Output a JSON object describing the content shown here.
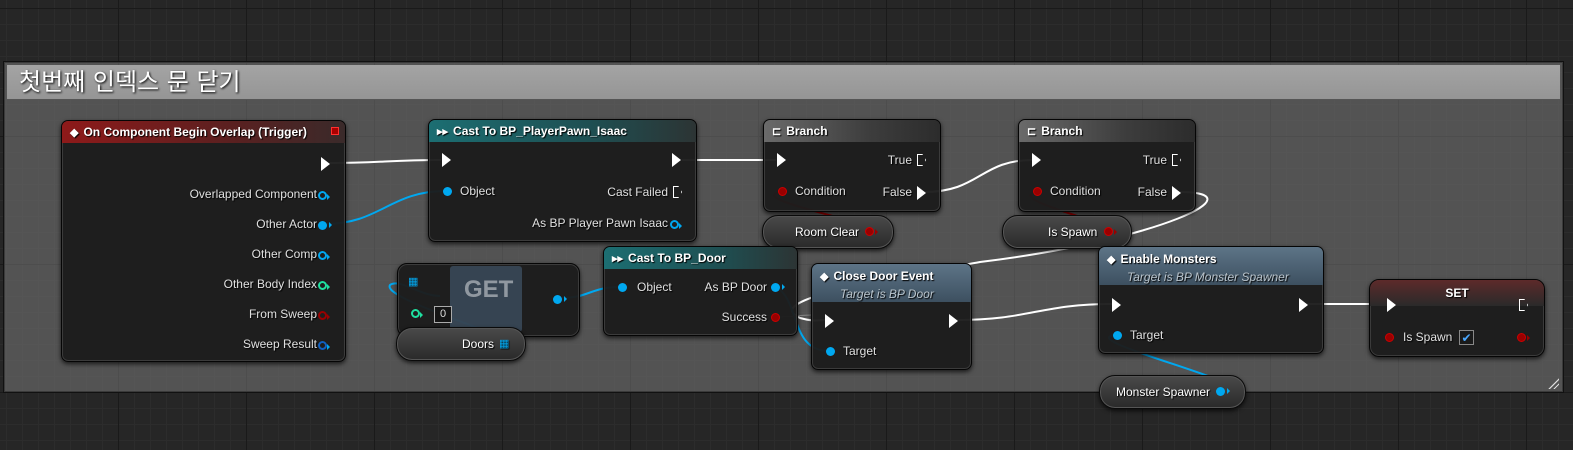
{
  "comment": {
    "title": "첫번째 인덱스 문 닫기"
  },
  "nodes": {
    "begin_overlap": {
      "title": "On Component Begin Overlap (Trigger)",
      "pins": [
        "Overlapped Component",
        "Other Actor",
        "Other Comp",
        "Other Body Index",
        "From Sweep",
        "Sweep Result"
      ]
    },
    "cast_pawn": {
      "title": "Cast To BP_PlayerPawn_Isaac",
      "object": "Object",
      "cast_failed": "Cast Failed",
      "as_output": "As BP Player Pawn Isaac"
    },
    "branch1": {
      "title": "Branch",
      "condition": "Condition",
      "true_label": "True",
      "false_label": "False"
    },
    "branch2": {
      "title": "Branch",
      "condition": "Condition",
      "true_label": "True",
      "false_label": "False"
    },
    "get": {
      "label": "GET",
      "index": "0"
    },
    "doors_var": {
      "label": "Doors"
    },
    "cast_door": {
      "title": "Cast To BP_Door",
      "object": "Object",
      "as_output": "As BP Door",
      "success": "Success"
    },
    "close_door": {
      "title": "Close Door Event",
      "subtitle": "Target is BP Door",
      "target": "Target"
    },
    "enable_monsters": {
      "title": "Enable Monsters",
      "subtitle": "Target is BP Monster Spawner",
      "target": "Target"
    },
    "set_node": {
      "title": "SET",
      "var": "Is Spawn",
      "checked": true
    },
    "room_clear_var": {
      "label": "Room Clear"
    },
    "is_spawn_var": {
      "label": "Is Spawn"
    },
    "monster_spawner_var": {
      "label": "Monster Spawner"
    }
  },
  "colors": {
    "exec": "#ffffff",
    "object": "#00a8f0",
    "bool": "#9a0000",
    "int": "#1fe0a0",
    "struct": "#1060c0",
    "event_header": "#8e1a1a",
    "cast_header": "#1c6e72",
    "function_header": "#5d7487"
  }
}
